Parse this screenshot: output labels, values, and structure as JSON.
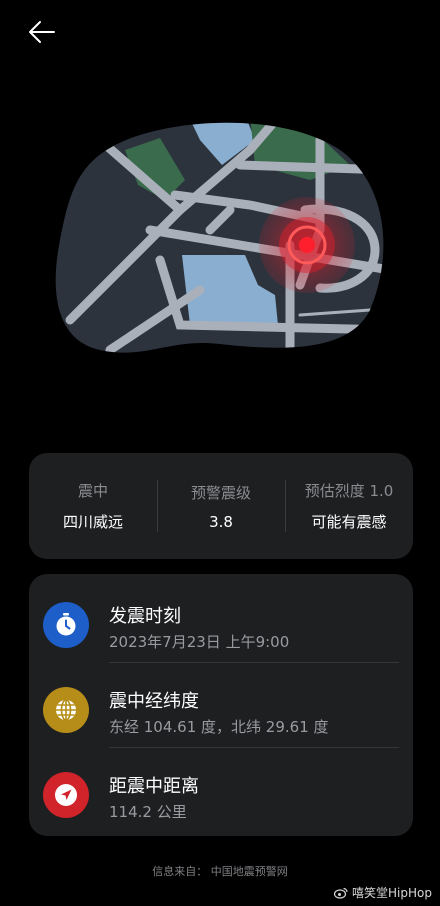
{
  "header": {
    "back_icon": "arrow-left-icon"
  },
  "map": {
    "land_color": "#2c333d",
    "road_color": "#a9b0ba",
    "water_color": "#8aaed0",
    "park_color": "#3a6b4c",
    "epicenter_color": "#e0202c"
  },
  "summary": {
    "epicenter_label": "震中",
    "epicenter_value": "四川威远",
    "warning_level_label": "预警震级",
    "warning_level_value": "3.8",
    "intensity_label": "预估烈度 1.0",
    "intensity_value": "可能有震感"
  },
  "details": {
    "time": {
      "icon": "clock-icon",
      "icon_color": "#1d5ec9",
      "title": "发震时刻",
      "value": "2023年7月23日 上午9:00"
    },
    "coords": {
      "icon": "globe-icon",
      "icon_color": "#b58d18",
      "title": "震中经纬度",
      "value": "东经 104.61 度，北纬 29.61 度"
    },
    "distance": {
      "icon": "location-arrow-icon",
      "icon_color": "#d0232a",
      "title": "距震中距离",
      "value": "114.2 公里"
    }
  },
  "footer": {
    "source": "信息来自：  中国地震预警网",
    "watermark": "嘻笑堂HipHop"
  }
}
